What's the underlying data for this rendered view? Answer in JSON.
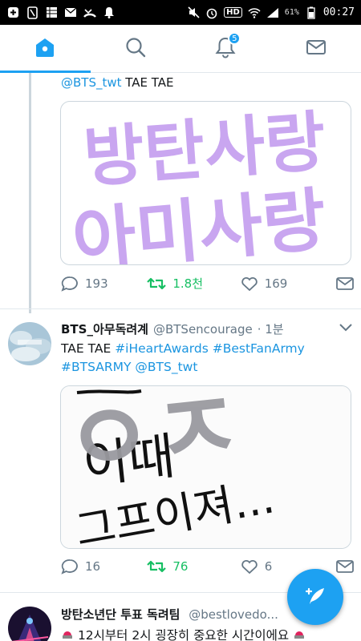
{
  "status_bar": {
    "battery": "61%",
    "time": "00:27",
    "hd_label": "HD"
  },
  "nav": {
    "notifications_badge": "5",
    "tabs": [
      "home",
      "search",
      "notifications",
      "messages"
    ]
  },
  "tweet1": {
    "mention": "@BTS_twt",
    "text": " TAE TAE",
    "image_lines": [
      "방탄사랑",
      "아미사랑"
    ],
    "replies": "193",
    "retweets": "1.8천",
    "likes": "169"
  },
  "tweet2": {
    "name": "BTS_아무독려계",
    "handle": "@BTSencourage",
    "time": "· 1분",
    "text_prefix": "TAE TAE ",
    "hashtag1": "#iHeartAwards",
    "hashtag2": "#BestFanArmy",
    "hashtag3": "#BTSARMY",
    "mention": "@BTS_twt",
    "image_lines": [
      "이때",
      "그프이져..."
    ],
    "image_mark": "ㅇㅈ",
    "replies": "16",
    "retweets": "76",
    "likes": "6"
  },
  "tweet3": {
    "name": "방탄소년단 투표 독려팀",
    "handle": "@bestlovedo...",
    "text": "12시부터 2시 굉장히 중요한 시간이에요"
  },
  "colors": {
    "accent": "#1da1f2",
    "retweet": "#17bf63",
    "muted": "#657786",
    "lilac": "#c9a6f0"
  }
}
